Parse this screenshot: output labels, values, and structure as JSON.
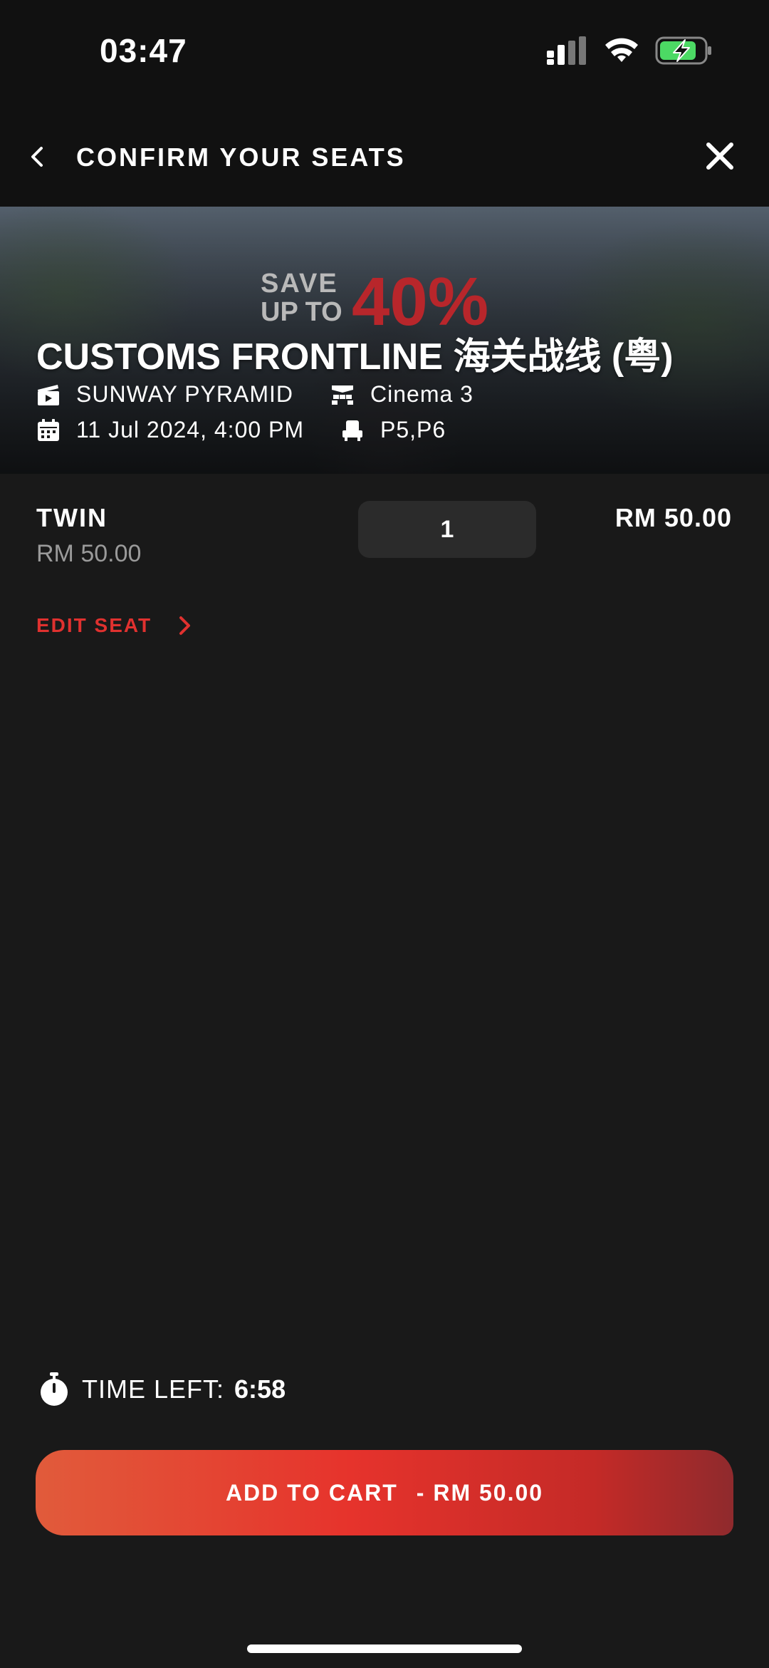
{
  "status_bar": {
    "time": "03:47"
  },
  "header": {
    "title": "CONFIRM YOUR SEATS"
  },
  "banner": {
    "promo_line1": "SAVE",
    "promo_line2": "UP TO",
    "promo_percent": "40%",
    "movie_title": "CUSTOMS FRONTLINE 海关战线 (粤)",
    "venue": "SUNWAY PYRAMID",
    "hall": "Cinema 3",
    "showtime": "11 Jul 2024, 4:00 PM",
    "seats": "P5,P6"
  },
  "ticket": {
    "type": "TWIN",
    "unit_price": "RM 50.00",
    "quantity": "1",
    "total": "RM 50.00",
    "edit_label": "EDIT SEAT"
  },
  "timer": {
    "label": "TIME LEFT:",
    "value": "6:58"
  },
  "cta": {
    "label": "ADD TO CART",
    "price": "- RM 50.00"
  },
  "colors": {
    "accent": "#e0312f",
    "background": "#191919",
    "header": "#111111"
  }
}
